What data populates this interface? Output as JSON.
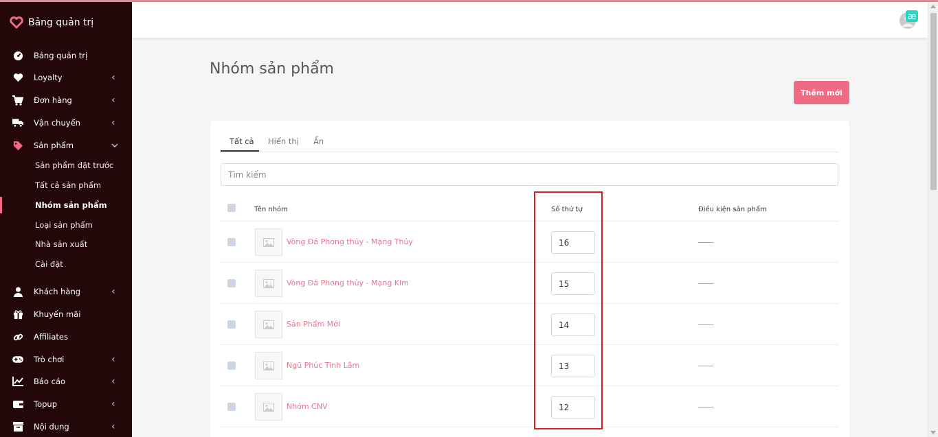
{
  "sidebar": {
    "brand": "Bảng quản trị",
    "items": [
      {
        "label": "Bảng quản trị",
        "icon": "dashboard-icon",
        "chevron": ""
      },
      {
        "label": "Loyalty",
        "icon": "heart-icon",
        "chevron": "‹"
      },
      {
        "label": "Đơn hàng",
        "icon": "cart-icon",
        "chevron": "‹"
      },
      {
        "label": "Vận chuyển",
        "icon": "truck-icon",
        "chevron": "‹"
      },
      {
        "label": "Sản phẩm",
        "icon": "tag-icon",
        "chevron": "⌄"
      },
      {
        "label": "Khách hàng",
        "icon": "user-icon",
        "chevron": "‹"
      },
      {
        "label": "Khuyến mãi",
        "icon": "gift-icon",
        "chevron": ""
      },
      {
        "label": "Affiliates",
        "icon": "link-icon",
        "chevron": ""
      },
      {
        "label": "Trò chơi",
        "icon": "gamepad-icon",
        "chevron": "‹"
      },
      {
        "label": "Báo cáo",
        "icon": "chart-icon",
        "chevron": "‹"
      },
      {
        "label": "Topup",
        "icon": "wallet-icon",
        "chevron": "‹"
      },
      {
        "label": "Nội dung",
        "icon": "archive-icon",
        "chevron": "‹"
      }
    ],
    "sub_items": [
      {
        "label": "Sản phẩm đặt trước"
      },
      {
        "label": "Tất cả sản phẩm"
      },
      {
        "label": "Nhóm sản phẩm"
      },
      {
        "label": "Loại sản phẩm"
      },
      {
        "label": "Nhà sản xuất"
      },
      {
        "label": "Cài đặt"
      }
    ],
    "active_sub": "Nhóm sản phẩm"
  },
  "topbar": {
    "avatar_text": "æ"
  },
  "page": {
    "title": "Nhóm sản phẩm",
    "add_button": "Thêm mới"
  },
  "tabs": [
    {
      "label": "Tất cả",
      "active": true
    },
    {
      "label": "Hiển thị",
      "active": false
    },
    {
      "label": "Ẩn",
      "active": false
    }
  ],
  "search": {
    "placeholder": "Tìm kiếm",
    "value": ""
  },
  "table": {
    "headers": {
      "name": "Tên nhóm",
      "order": "Số thứ tự",
      "condition": "Điều kiện sản phẩm"
    },
    "rows": [
      {
        "name": "Vòng Đá Phong thủy - Mạng Thủy",
        "order": "16"
      },
      {
        "name": "Vòng Đá Phong thủy - Mạng Kim",
        "order": "15"
      },
      {
        "name": "Sản Phẩm Mới",
        "order": "14"
      },
      {
        "name": "Ngũ Phúc Tinh Lâm",
        "order": "13"
      },
      {
        "name": "Nhóm CNV",
        "order": "12"
      }
    ]
  },
  "colors": {
    "sidebar_bg": "#230709",
    "accent": "#f06a83",
    "link": "#e8728a",
    "highlight_box": "#d81e1e"
  }
}
